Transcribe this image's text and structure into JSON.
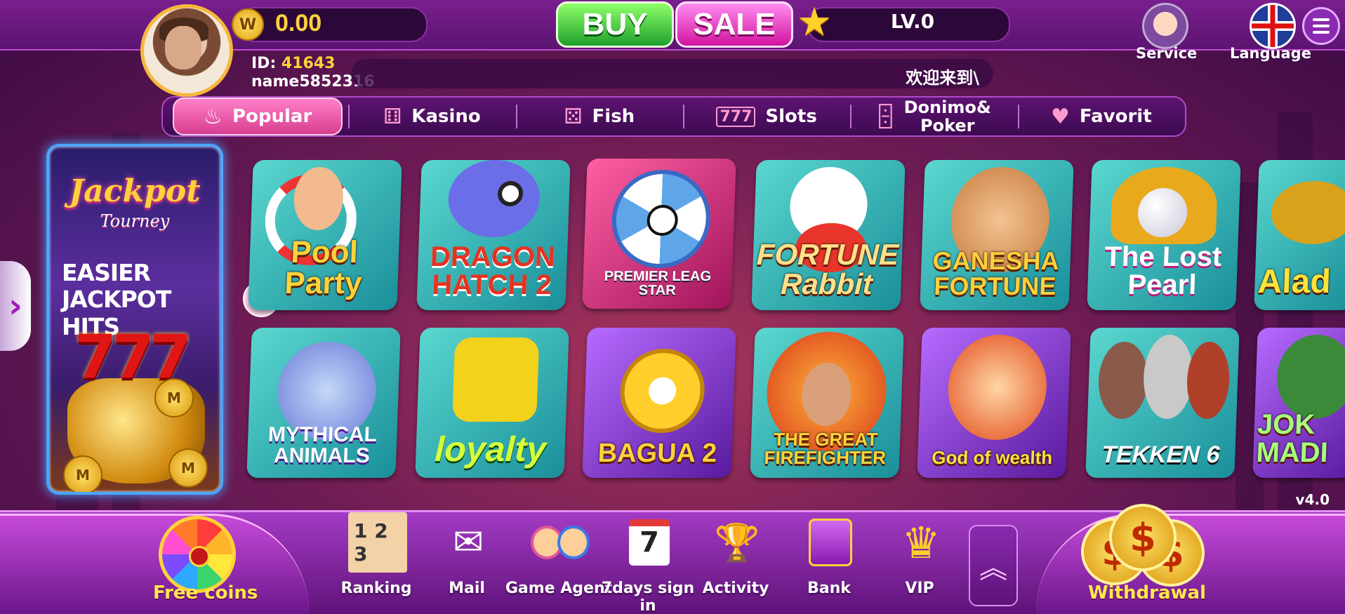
{
  "header": {
    "balance": "0.00",
    "coin_symbol": "W",
    "buy_label": "BUY",
    "sale_label": "SALE",
    "level": "LV.0",
    "user_id_label": "ID:",
    "user_id": "41643",
    "username": "name5852316",
    "marquee": "欢迎来到\\",
    "service_label": "Service",
    "language_label": "Language"
  },
  "tabs": [
    {
      "label": "Popular",
      "icon": "fire-icon",
      "active": true
    },
    {
      "label": "Kasino",
      "icon": "dice-icon"
    },
    {
      "label": "Fish",
      "icon": "dice-icon"
    },
    {
      "label": "Slots",
      "icon": "slot-machine-icon"
    },
    {
      "label": "Donimo&",
      "label2": "Poker",
      "icon": "domino-icon"
    },
    {
      "label": "Favorit",
      "icon": "heart-icon"
    }
  ],
  "jackpot": {
    "title": "Jackpot",
    "subtitle": "Tourney",
    "line1": "EASIER",
    "line2": "JACKPOT HITS",
    "numerals": "777"
  },
  "games": [
    {
      "title": "Pool Party"
    },
    {
      "title": "DRAGON HATCH 2"
    },
    {
      "title": "PREMIER LEAG STAR"
    },
    {
      "title": "FORTUNE Rabbit"
    },
    {
      "title": "GANESHA FORTUNE"
    },
    {
      "title": "The Lost Pearl"
    },
    {
      "title": "Alad"
    },
    {
      "title": "MYTHICAL ANIMALS"
    },
    {
      "title": "loyalty"
    },
    {
      "title": "BAGUA 2"
    },
    {
      "title": "THE GREAT FIREFIGHTER"
    },
    {
      "title": "God of wealth"
    },
    {
      "title": "TEKKEN 6"
    },
    {
      "title": "JOK MADI"
    }
  ],
  "version": "v4.0",
  "bottom": {
    "free_coins": "Free coins",
    "items": [
      {
        "label": "Ranking",
        "icon": "podium-icon"
      },
      {
        "label": "Mail",
        "icon": "mailbox-icon"
      },
      {
        "label": "Game Agent",
        "icon": "agents-icon"
      },
      {
        "label": "7days sign in",
        "icon": "calendar-icon"
      },
      {
        "label": "Activity",
        "icon": "trophy-icon"
      },
      {
        "label": "Bank",
        "icon": "safe-icon"
      },
      {
        "label": "VIP",
        "icon": "crown-icon"
      }
    ],
    "withdrawal": "Withdrawal"
  },
  "colors": {
    "accent_gold": "#ffd23a",
    "buy_green": "#1ea12b",
    "sale_pink": "#d2139f",
    "bar_purple": "#7a1f8e"
  }
}
